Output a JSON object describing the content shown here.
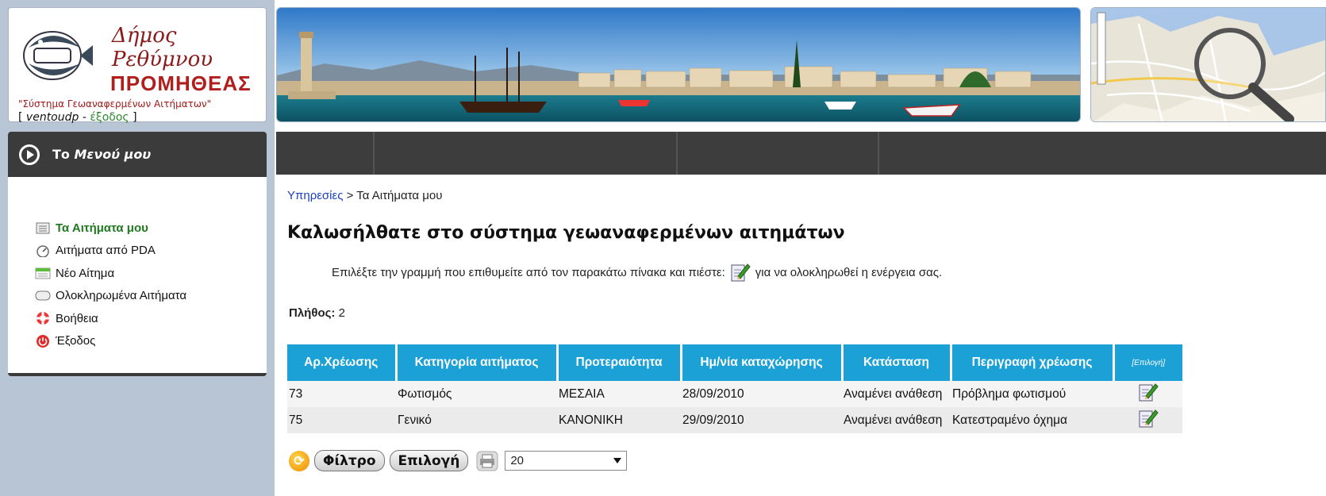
{
  "header": {
    "municipality": "Δήμος Ρεθύμνου",
    "brand": "ΠΡΟΜΗΘΕΑΣ",
    "tagline": "\"Σύστημα Γεωαναφερμένων Αιτήματων\"",
    "user": {
      "open": "[ ",
      "username": "ventoudp",
      "sep": " - ",
      "logout": "έξοδος",
      "close": " ]"
    }
  },
  "menu": {
    "title_prefix": "Το ",
    "title_em": "Μενού μου",
    "items": [
      {
        "label": "Τα Αιτήματα μου",
        "icon": "document-list-icon"
      },
      {
        "label": "Αιτήματα από PDA",
        "icon": "speedometer-icon"
      },
      {
        "label": "Νέο Αίτημα",
        "icon": "new-request-icon"
      },
      {
        "label": "Ολοκληρωμένα Αιτήματα",
        "icon": "speech-bubble-icon"
      },
      {
        "label": "Βοήθεια",
        "icon": "lifebuoy-icon"
      },
      {
        "label": "Έξοδος",
        "icon": "power-icon"
      }
    ]
  },
  "breadcrumb": {
    "link": "Υπηρεσίες",
    "separator": " > ",
    "current": "Τα Αιτήματα μου"
  },
  "page_title": "Καλωσήλθατε στο σύστημα γεωαναφερμένων αιτημάτων",
  "instruction": {
    "before": "Επιλέξτε την γραμμή που επιθυμείτε από τον παρακάτω πίνακα και πιέστε:",
    "after": "για να ολοκληρωθεί η ενέργεια σας."
  },
  "count": {
    "label": "Πλήθος:",
    "value": "2"
  },
  "table": {
    "columns": [
      "Αρ.Χρέωσης",
      "Κατηγορία αιτήματος",
      "Προτεραιότητα",
      "Ημ/νία καταχώρησης",
      "Κατάσταση",
      "Περιγραφή χρέωσης",
      "[Επιλογή]"
    ],
    "rows": [
      [
        "73",
        "Φωτισμός",
        "ΜΕΣΑΙΑ",
        "28/09/2010",
        "Αναμένει ανάθεση",
        "Πρόβλημα φωτισμού"
      ],
      [
        "75",
        "Γενικό",
        "ΚΑΝΟΝΙΚΗ",
        "29/09/2010",
        "Αναμένει ανάθεση",
        "Κατεστραμένο όχημα"
      ]
    ]
  },
  "toolbar": {
    "filter_label": "Φίλτρο",
    "select_label": "Επιλογή",
    "page_size": "20"
  },
  "colors": {
    "table_header": "#1ba1d6",
    "active_menu": "#1f7a1f",
    "link": "#1a3fbf",
    "dark_bar": "#3d3d3d"
  }
}
